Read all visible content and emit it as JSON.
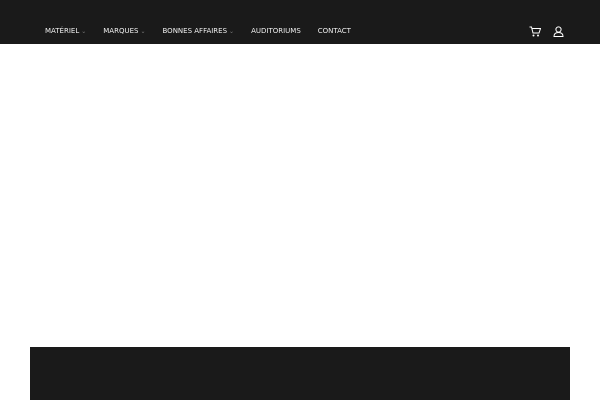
{
  "nav": {
    "items": [
      {
        "label": "MATÉRIEL",
        "dropdown": true
      },
      {
        "label": "MARQUES",
        "dropdown": true
      },
      {
        "label": "BONNES AFFAIRES",
        "dropdown": true
      },
      {
        "label": "AUDITORIUMS",
        "dropdown": false
      },
      {
        "label": "CONTACT",
        "dropdown": false
      }
    ],
    "icons": [
      "cart-icon",
      "user-icon"
    ]
  }
}
